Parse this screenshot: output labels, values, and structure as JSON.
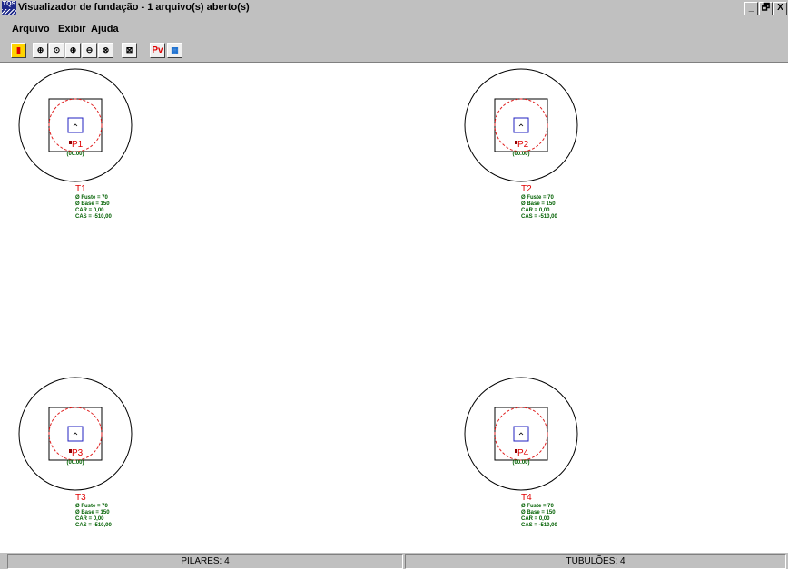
{
  "window": {
    "icon_text": "TQS",
    "title": "Visualizador de fundação - 1 arquivo(s) aberto(s)",
    "controls": [
      "_",
      "🗗",
      "X"
    ]
  },
  "menu": [
    "Arquivo",
    "Exibir",
    "Ajuda"
  ],
  "toolbar": [
    {
      "name": "exit-icon",
      "glyph": "▮"
    },
    {
      "name": "zoom-window-icon",
      "glyph": "⊕"
    },
    {
      "name": "zoom-pan-icon",
      "glyph": "⊙"
    },
    {
      "name": "zoom-all-icon",
      "glyph": "⊕"
    },
    {
      "name": "zoom-out-icon",
      "glyph": "⊖"
    },
    {
      "name": "zoom-previous-icon",
      "glyph": "⊗"
    },
    {
      "name": "toggle-icon",
      "glyph": "⊠"
    },
    {
      "name": "pv-icon",
      "glyph": "Pv"
    },
    {
      "name": "colors-icon",
      "glyph": "▦"
    }
  ],
  "elements": [
    {
      "tub": "T1",
      "pilar": "P1",
      "tag": "(00.00)",
      "fuste": "Ø Fuste = 70",
      "base": "Ø Base = 150",
      "car": "CAR = 0,00",
      "cas": "CAS = -510,00"
    },
    {
      "tub": "T2",
      "pilar": "P2",
      "tag": "(00.00)",
      "fuste": "Ø Fuste = 70",
      "base": "Ø Base = 150",
      "car": "CAR = 0,00",
      "cas": "CAS = -510,00"
    },
    {
      "tub": "T3",
      "pilar": "P3",
      "tag": "(00.00)",
      "fuste": "Ø Fuste = 70",
      "base": "Ø Base = 150",
      "car": "CAR = 0,00",
      "cas": "CAS = -510,00"
    },
    {
      "tub": "T4",
      "pilar": "P4",
      "tag": "(00.00)",
      "fuste": "Ø Fuste = 70",
      "base": "Ø Base = 150",
      "car": "CAR = 0,00",
      "cas": "CAS = -510,00"
    }
  ],
  "status": {
    "pilares": "PILARES: 4",
    "tubuloes": "TUBULÕES: 4"
  },
  "colors": {
    "label_red": "#e00000",
    "text_green": "#006000",
    "pillar_blue": "#2020c0",
    "dashed_red": "#e02020"
  }
}
